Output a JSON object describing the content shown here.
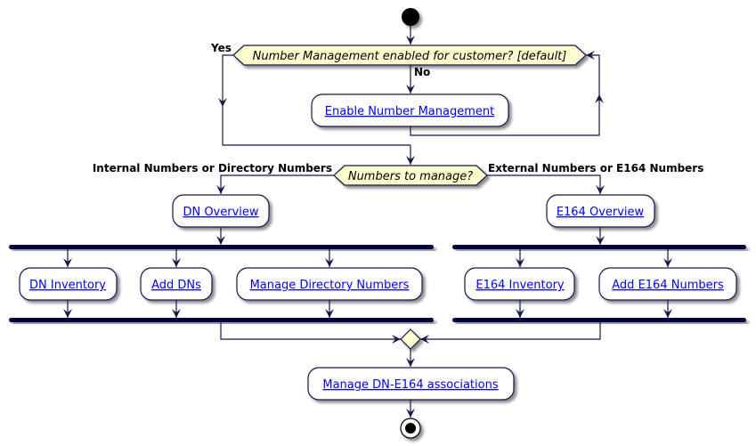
{
  "diagram": {
    "type": "activity",
    "start": "start",
    "decision1": {
      "question": "Number Management enabled for customer? [default]",
      "yes_label": "Yes",
      "no_label": "No"
    },
    "enable_action": "Enable Number Management",
    "decision2": {
      "question": "Numbers to manage?",
      "left_label": "Internal Numbers or Directory Numbers",
      "right_label": "External Numbers or E164 Numbers"
    },
    "dn_overview": "DN Overview",
    "e164_overview": "E164 Overview",
    "dn_branch": [
      "DN Inventory",
      "Add DNs",
      "Manage Directory Numbers"
    ],
    "e164_branch": [
      "E164 Inventory",
      "Add E164 Numbers"
    ],
    "final_action": "Manage DN-E164 associations",
    "end": "stop"
  },
  "colors": {
    "edge": "#181848",
    "link": "#0000ee",
    "decision_fill": "#fefece",
    "bar": "#000040"
  }
}
